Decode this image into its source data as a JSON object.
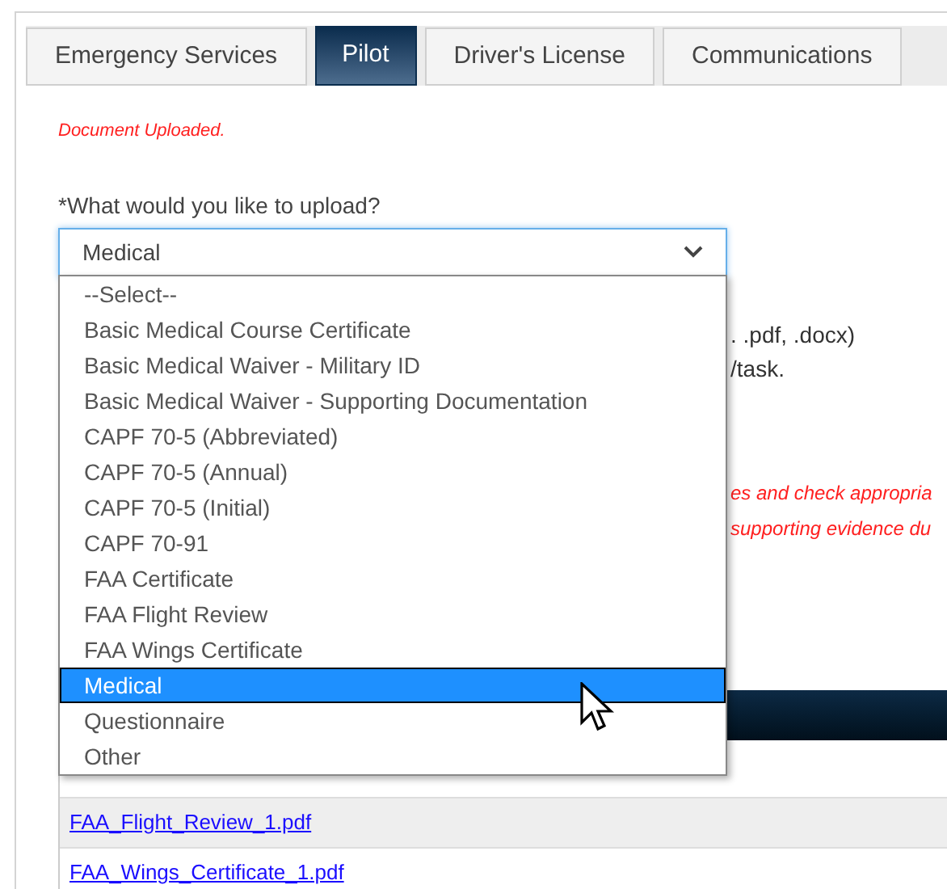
{
  "tabs": [
    {
      "label": "Emergency Services",
      "selected": false
    },
    {
      "label": "Pilot",
      "selected": true
    },
    {
      "label": "Driver's License",
      "selected": false
    },
    {
      "label": "Communications",
      "selected": false
    }
  ],
  "status_message": "Document Uploaded.",
  "question": "*What would you like to upload?",
  "upload_select": {
    "value": "Medical",
    "expanded": true,
    "options": [
      {
        "label": "--Select--",
        "selected": false
      },
      {
        "label": "Basic Medical Course Certificate",
        "selected": false
      },
      {
        "label": "Basic Medical Waiver - Military ID",
        "selected": false
      },
      {
        "label": "Basic Medical Waiver - Supporting Documentation",
        "selected": false
      },
      {
        "label": "CAPF 70-5 (Abbreviated)",
        "selected": false
      },
      {
        "label": "CAPF 70-5 (Annual)",
        "selected": false
      },
      {
        "label": "CAPF 70-5 (Initial)",
        "selected": false
      },
      {
        "label": "CAPF 70-91",
        "selected": false
      },
      {
        "label": "FAA Certificate",
        "selected": false
      },
      {
        "label": "FAA Flight Review",
        "selected": false
      },
      {
        "label": "FAA Wings Certificate",
        "selected": false
      },
      {
        "label": "Medical",
        "selected": true
      },
      {
        "label": "Questionnaire",
        "selected": false
      },
      {
        "label": "Other",
        "selected": false
      }
    ]
  },
  "instructions": [
    ". .pdf, .docx)",
    "/task."
  ],
  "warnings": [
    "es and check appropria",
    "supporting evidence du"
  ],
  "documents": [
    {
      "file": "FAA_Flight_Review_1.pdf"
    },
    {
      "file": "FAA_Wings_Certificate_1.pdf"
    }
  ]
}
